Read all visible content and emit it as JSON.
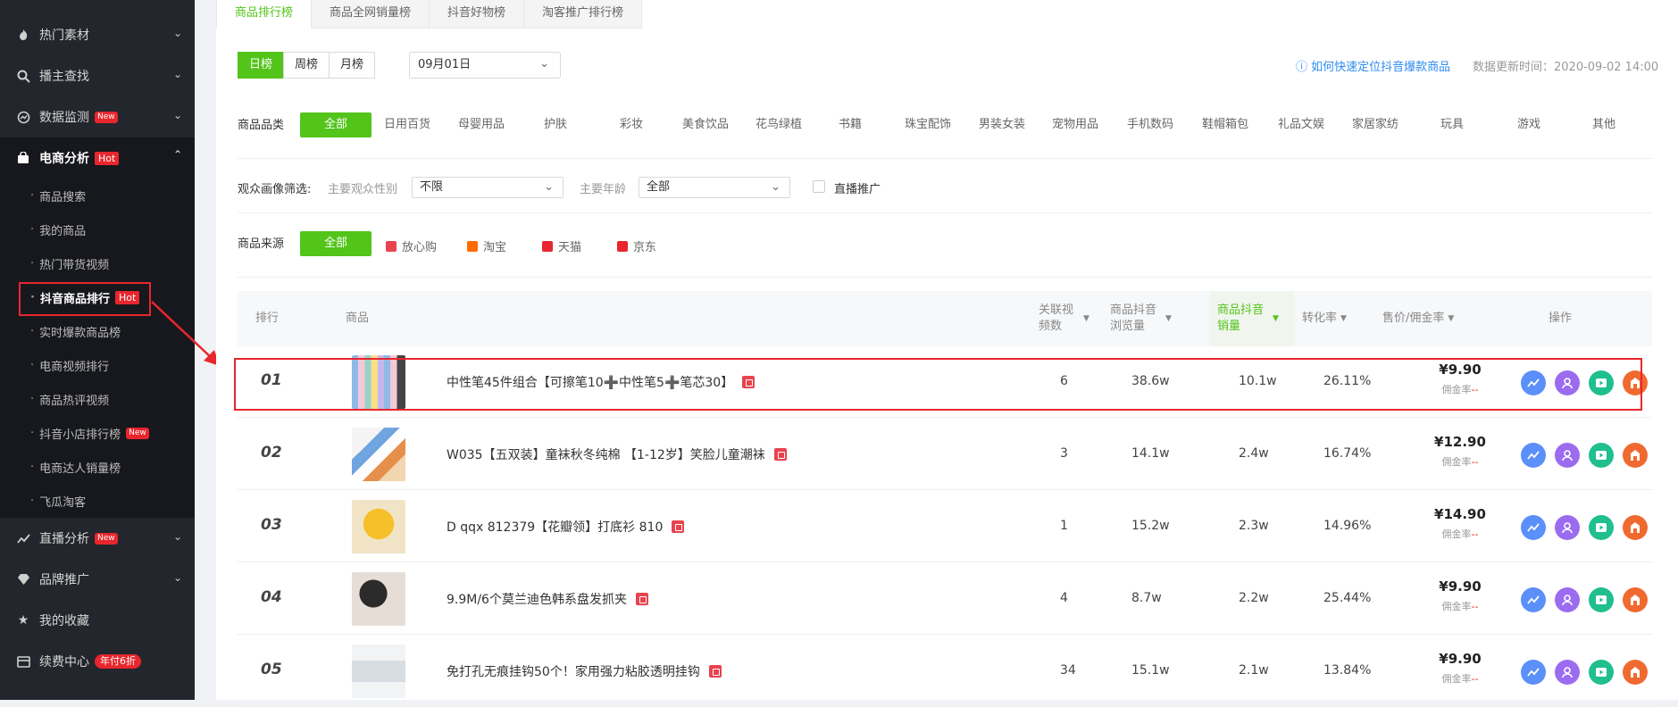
{
  "sidebar": {
    "items": [
      {
        "label": "热门素材",
        "icon": "fire-icon"
      },
      {
        "label": "播主查找",
        "icon": "search-icon"
      },
      {
        "label": "数据监测",
        "icon": "monitor-icon",
        "badge": "New"
      },
      {
        "label": "电商分析",
        "icon": "shop-bag-icon",
        "badge": "Hot"
      },
      {
        "label": "直播分析",
        "icon": "trend-icon",
        "badge": "New"
      },
      {
        "label": "品牌推广",
        "icon": "diamond-icon"
      },
      {
        "label": "我的收藏",
        "icon": "star-icon"
      },
      {
        "label": "续费中心",
        "icon": "card-icon",
        "badge": "年付6折"
      }
    ],
    "sub_items": [
      {
        "label": "商品搜索"
      },
      {
        "label": "我的商品"
      },
      {
        "label": "热门带货视频"
      },
      {
        "label": "抖音商品排行",
        "badge": "Hot"
      },
      {
        "label": "实时爆款商品榜"
      },
      {
        "label": "电商视频排行"
      },
      {
        "label": "商品热评视频"
      },
      {
        "label": "抖音小店排行榜",
        "badge": "New"
      },
      {
        "label": "电商达人销量榜"
      },
      {
        "label": "飞瓜淘客"
      }
    ]
  },
  "tabs": [
    "商品排行榜",
    "商品全网销量榜",
    "抖音好物榜",
    "淘客推广排行榜"
  ],
  "period": [
    "日榜",
    "周榜",
    "月榜"
  ],
  "date": "09月01日",
  "help_link": "如何快速定位抖音爆款商品",
  "update_time": "数据更新时间：2020-09-02 14:00",
  "category": {
    "label": "商品品类",
    "options": [
      "全部",
      "日用百货",
      "母婴用品",
      "护肤",
      "彩妆",
      "美食饮品",
      "花鸟绿植",
      "书籍",
      "珠宝配饰",
      "男装女装",
      "宠物用品",
      "手机数码",
      "鞋帽箱包",
      "礼品文娱",
      "家居家纺",
      "玩具",
      "游戏",
      "其他"
    ]
  },
  "audience": {
    "label": "观众画像筛选:",
    "gender_label": "主要观众性别",
    "gender_value": "不限",
    "age_label": "主要年龄",
    "age_value": "全部",
    "live_label": "直播推广"
  },
  "source": {
    "label": "商品来源",
    "options": [
      {
        "name": "全部"
      },
      {
        "name": "放心购",
        "color": "#e8434e"
      },
      {
        "name": "淘宝",
        "color": "#ff6a00"
      },
      {
        "name": "天猫",
        "color": "#e8262d"
      },
      {
        "name": "京东",
        "color": "#e8262d"
      }
    ]
  },
  "table": {
    "headers": {
      "rank": "排行",
      "product": "商品",
      "videos": "关联视频数",
      "views": "商品抖音浏览量",
      "sales": "商品抖音销量",
      "conv": "转化率",
      "price": "售价/佣金率",
      "ops": "操作"
    },
    "commission_label": "佣金率",
    "commission_value": "--",
    "rows": [
      {
        "rank": "01",
        "name": "中性笔45件组合【可擦笔10➕中性笔5➕笔芯30】",
        "videos": "6",
        "views": "38.6w",
        "sales": "10.1w",
        "conv": "26.11%",
        "price": "¥9.90"
      },
      {
        "rank": "02",
        "name": "W035【五双装】童袜秋冬纯棉 【1-12岁】笑脸儿童潮袜",
        "videos": "3",
        "views": "14.1w",
        "sales": "2.4w",
        "conv": "16.74%",
        "price": "¥12.90"
      },
      {
        "rank": "03",
        "name": "D qqx 812379【花瓣领】打底衫 810",
        "videos": "1",
        "views": "15.2w",
        "sales": "2.3w",
        "conv": "14.96%",
        "price": "¥14.90"
      },
      {
        "rank": "04",
        "name": "9.9M/6个莫兰迪色韩系盘发抓夹",
        "videos": "4",
        "views": "8.7w",
        "sales": "2.2w",
        "conv": "25.44%",
        "price": "¥9.90"
      },
      {
        "rank": "05",
        "name": "免打孔无痕挂钩50个！家用强力粘胶透明挂钩",
        "videos": "34",
        "views": "15.1w",
        "sales": "2.1w",
        "conv": "13.84%",
        "price": "¥9.90"
      }
    ]
  },
  "colors": {
    "accent": "#52c41a",
    "highlight": "#e8262d",
    "sidebar_bg": "#24262d"
  }
}
